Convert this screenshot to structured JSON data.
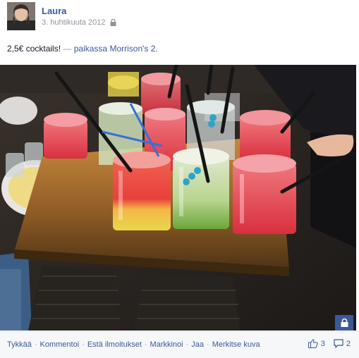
{
  "post": {
    "author": "Laura",
    "date": "3. huhtikuuta 2012",
    "text": "2,5€ cocktails!",
    "separator": "—",
    "location_prefix": "paikassa",
    "location": "Morrison's 2."
  },
  "actions": {
    "like": "Tykkää",
    "comment": "Kommentoi",
    "hide": "Estä ilmoitukset",
    "promote": "Markkinoi",
    "share": "Jaa",
    "tag": "Merkitse kuva"
  },
  "counts": {
    "likes": "3",
    "comments": "2"
  },
  "colors": {
    "link": "#3b5998",
    "meta": "#90949c",
    "footer_bg": "#f6f7f9"
  },
  "icons": [
    "lock-icon",
    "thumbs-up-icon",
    "comment-icon"
  ]
}
